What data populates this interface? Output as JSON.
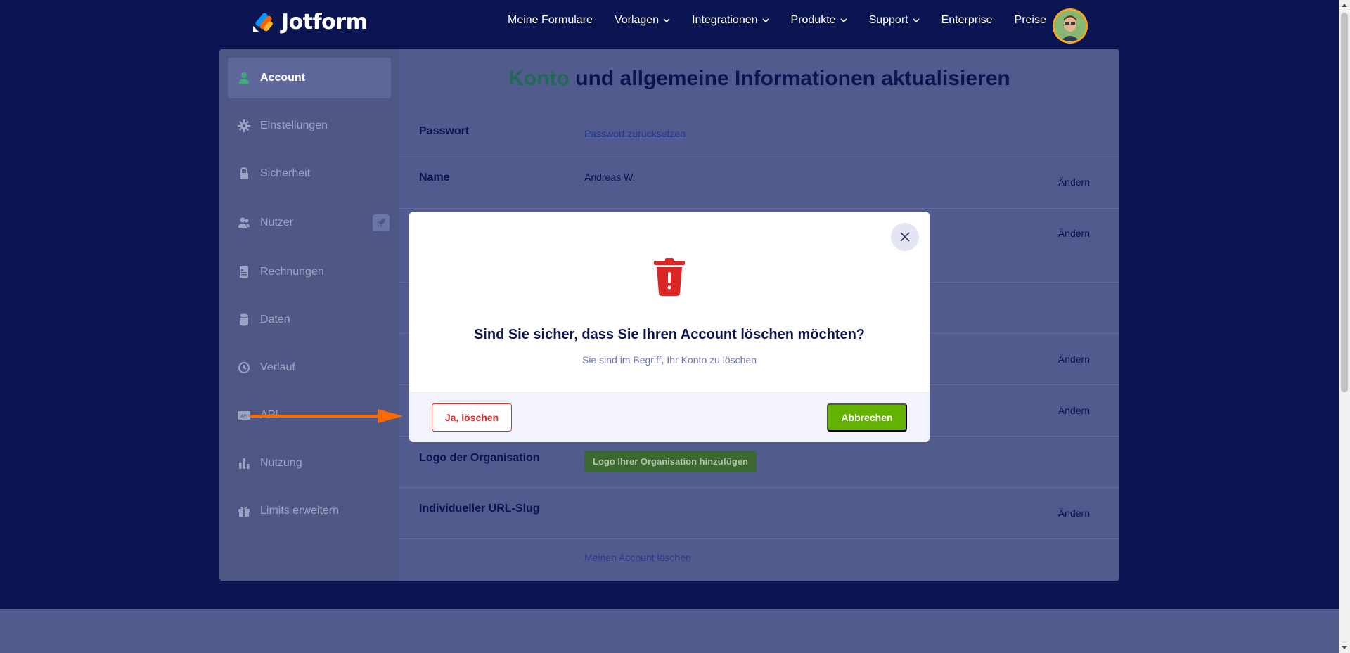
{
  "header": {
    "brand": "Jotform",
    "nav": [
      {
        "label": "Meine Formulare",
        "dropdown": false
      },
      {
        "label": "Vorlagen",
        "dropdown": true
      },
      {
        "label": "Integrationen",
        "dropdown": true
      },
      {
        "label": "Produkte",
        "dropdown": true
      },
      {
        "label": "Support",
        "dropdown": true
      },
      {
        "label": "Enterprise",
        "dropdown": false
      },
      {
        "label": "Preise",
        "dropdown": false
      }
    ]
  },
  "sidebar": {
    "items": [
      {
        "label": "Account",
        "icon": "user-icon",
        "active": true
      },
      {
        "label": "Einstellungen",
        "icon": "gear-icon"
      },
      {
        "label": "Sicherheit",
        "icon": "lock-icon"
      },
      {
        "label": "Nutzer",
        "icon": "users-icon",
        "badge_icon": "rocket-icon"
      },
      {
        "label": "Rechnungen",
        "icon": "invoice-icon"
      },
      {
        "label": "Daten",
        "icon": "database-icon"
      },
      {
        "label": "Verlauf",
        "icon": "history-icon"
      },
      {
        "label": "API",
        "icon": "api-icon"
      },
      {
        "label": "Nutzung",
        "icon": "bar-chart-icon"
      },
      {
        "label": "Limits erweitern",
        "icon": "gift-icon"
      }
    ]
  },
  "main": {
    "heading_accent": "Konto",
    "heading_rest": " und allgemeine Informationen aktualisieren",
    "rows": {
      "password": {
        "label": "Passwort",
        "link": "Passwort zurücksetzen"
      },
      "name": {
        "label": "Name",
        "value": "Andreas W.",
        "action": "Ändern"
      },
      "row3": {
        "action": "Ändern"
      },
      "row5": {
        "action": "Ändern"
      },
      "row6": {
        "action": "Ändern"
      },
      "org_logo": {
        "label": "Logo der Organisation",
        "button": "Logo Ihrer Organisation hinzufügen"
      },
      "url_slug": {
        "label": "Individueller URL-Slug",
        "action": "Ändern"
      },
      "delete": {
        "link": "Meinen Account löschen"
      }
    }
  },
  "modal": {
    "title": "Sind Sie sicher, dass Sie Ihren Account löschen möchten?",
    "subtitle": "Sie sind im Begriff, Ihr Konto zu löschen",
    "confirm_label": "Ja, löschen",
    "cancel_label": "Abbrechen",
    "icon": "trash-warning-icon"
  },
  "colors": {
    "navy": "#0a1551",
    "danger": "#d32f2f",
    "success": "#64b200",
    "arrow": "#ff6a00"
  }
}
